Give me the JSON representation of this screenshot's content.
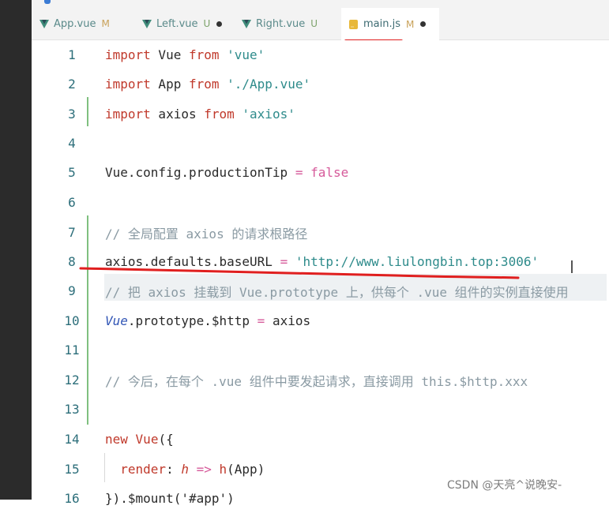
{
  "tabs": [
    {
      "name": "App.vue",
      "status": "M",
      "icon": "vue-icon",
      "active": false,
      "dirty": false
    },
    {
      "name": "Left.vue",
      "status": "U",
      "icon": "vue-icon",
      "active": false,
      "dirty": true
    },
    {
      "name": "Right.vue",
      "status": "U",
      "icon": "vue-icon",
      "active": false,
      "dirty": false
    },
    {
      "name": "main.js",
      "status": "M",
      "icon": "js-icon",
      "active": true,
      "dirty": true
    }
  ],
  "lines": [
    {
      "n": "1",
      "tokens": [
        [
          "kw",
          "import"
        ],
        [
          "",
          " Vue "
        ],
        [
          "kw",
          "from"
        ],
        [
          "",
          " "
        ],
        [
          "str",
          "'vue'"
        ]
      ]
    },
    {
      "n": "2",
      "tokens": [
        [
          "kw",
          "import"
        ],
        [
          "",
          " App "
        ],
        [
          "kw",
          "from"
        ],
        [
          "",
          " "
        ],
        [
          "str",
          "'./App.vue'"
        ]
      ]
    },
    {
      "n": "3",
      "tokens": [
        [
          "kw",
          "import"
        ],
        [
          "",
          " axios "
        ],
        [
          "kw",
          "from"
        ],
        [
          "",
          " "
        ],
        [
          "str",
          "'axios'"
        ]
      ]
    },
    {
      "n": "4",
      "tokens": []
    },
    {
      "n": "5",
      "tokens": [
        [
          "",
          "Vue.config.productionTip "
        ],
        [
          "op",
          "="
        ],
        [
          "",
          " "
        ],
        [
          "bool",
          "false"
        ]
      ]
    },
    {
      "n": "6",
      "tokens": []
    },
    {
      "n": "7",
      "tokens": [
        [
          "cm",
          "// 全局配置 axios 的请求根路径"
        ]
      ]
    },
    {
      "n": "8",
      "tokens": [
        [
          "",
          "axios.defaults.baseURL "
        ],
        [
          "op",
          "="
        ],
        [
          "",
          " "
        ],
        [
          "str",
          "'http://www.liulongbin.top:3006'"
        ]
      ]
    },
    {
      "n": "9",
      "tokens": [
        [
          "cm",
          "// 把 axios 挂载到 Vue.prototype 上，供每个 .vue 组件的实例直接使用"
        ]
      ]
    },
    {
      "n": "10",
      "tokens": [
        [
          "cls",
          "Vue"
        ],
        [
          "",
          ".prototype.$http "
        ],
        [
          "op",
          "="
        ],
        [
          "",
          " axios"
        ]
      ]
    },
    {
      "n": "11",
      "tokens": []
    },
    {
      "n": "12",
      "tokens": [
        [
          "cm",
          "// 今后，在每个 .vue 组件中要发起请求，直接调用 this.$http.xxx"
        ]
      ]
    },
    {
      "n": "13",
      "tokens": []
    },
    {
      "n": "14",
      "tokens": [
        [
          "kw",
          "new"
        ],
        [
          "",
          " "
        ],
        [
          "kw",
          "Vue"
        ],
        [
          "",
          "({"
        ]
      ]
    },
    {
      "n": "15",
      "tokens": [
        [
          "",
          "  "
        ],
        [
          "kw",
          "render"
        ],
        [
          "",
          ": "
        ],
        [
          "fn",
          "h"
        ],
        [
          "",
          " "
        ],
        [
          "op",
          "=>"
        ],
        [
          "",
          " "
        ],
        [
          "kw",
          "h"
        ],
        [
          "",
          "(App)"
        ]
      ]
    },
    {
      "n": "16",
      "tokens": [
        [
          "",
          "}).$mount('#app')"
        ]
      ]
    }
  ],
  "watermark": "CSDN @天亮^说晚安-",
  "colors": {
    "annotation_red": "#e01f1f",
    "accent_git_added": "#7fc07f"
  }
}
